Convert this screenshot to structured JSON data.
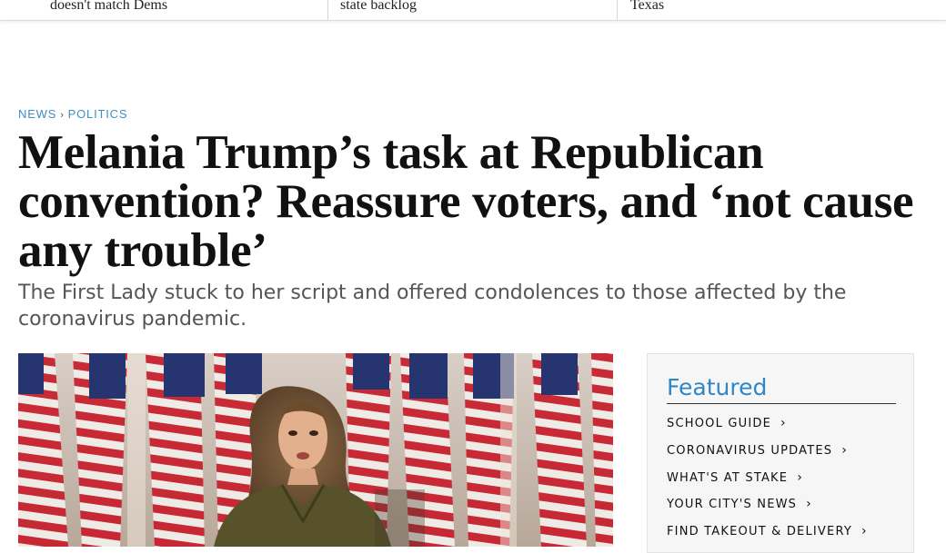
{
  "top_strip": {
    "items": [
      {
        "text": "doesn't match Dems"
      },
      {
        "text": "state backlog"
      },
      {
        "text": "Texas"
      }
    ]
  },
  "breadcrumb": {
    "section": "NEWS",
    "subsection": "POLITICS",
    "separator": "›"
  },
  "article": {
    "headline": "Melania Trump’s task at Republican convention? Reassure voters, and ‘not cause any trouble’",
    "dek": "The First Lady stuck to her script and offered condolences to those affected by the coronavirus pandemic."
  },
  "featured": {
    "title": "Featured",
    "items": [
      {
        "label": "SCHOOL GUIDE"
      },
      {
        "label": "CORONAVIRUS UPDATES"
      },
      {
        "label": "WHAT'S AT STAKE"
      },
      {
        "label": "YOUR CITY'S NEWS"
      },
      {
        "label": "FIND TAKEOUT & DELIVERY"
      }
    ],
    "chevron_icon": "chevron-right-icon"
  },
  "colors": {
    "accent_blue": "#2f86c7",
    "breadcrumb_blue": "#3f8fc4",
    "headline": "#111111",
    "dek": "#555555"
  }
}
